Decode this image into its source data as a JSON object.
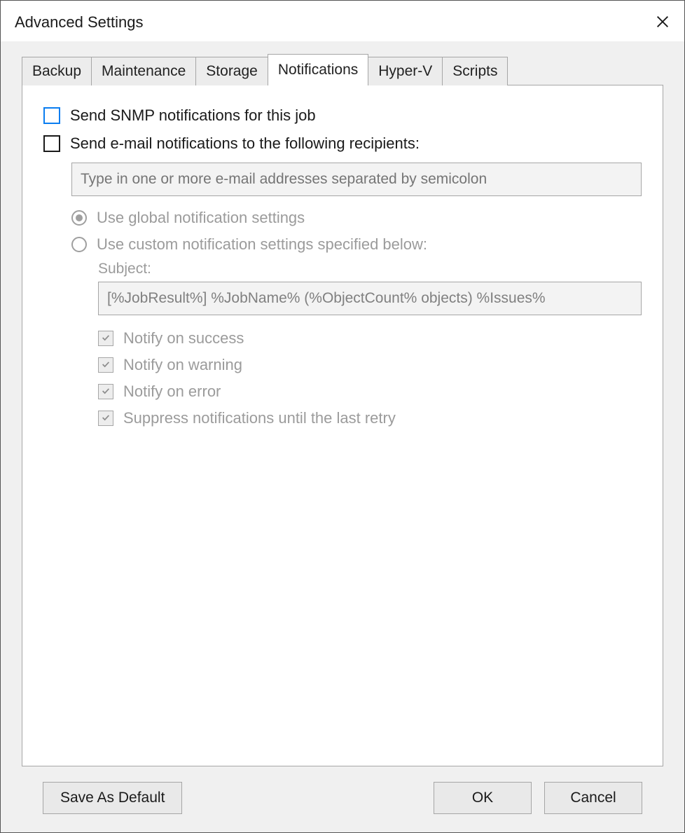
{
  "window": {
    "title": "Advanced Settings"
  },
  "tabs": [
    {
      "label": "Backup"
    },
    {
      "label": "Maintenance"
    },
    {
      "label": "Storage"
    },
    {
      "label": "Notifications",
      "active": true
    },
    {
      "label": "Hyper-V"
    },
    {
      "label": "Scripts"
    }
  ],
  "notifications": {
    "snmp_label": "Send SNMP notifications for this job",
    "email_label": "Send e-mail notifications to the following recipients:",
    "email_placeholder": "Type in one or more e-mail addresses separated by semicolon",
    "radio_global": "Use global notification settings",
    "radio_custom": "Use custom notification settings specified below:",
    "subject_label": "Subject:",
    "subject_value": "[%JobResult%] %JobName% (%ObjectCount% objects) %Issues%",
    "notify_success": "Notify on success",
    "notify_warning": "Notify on warning",
    "notify_error": "Notify on error",
    "suppress": "Suppress notifications until the last retry"
  },
  "footer": {
    "save_default": "Save As Default",
    "ok": "OK",
    "cancel": "Cancel"
  }
}
